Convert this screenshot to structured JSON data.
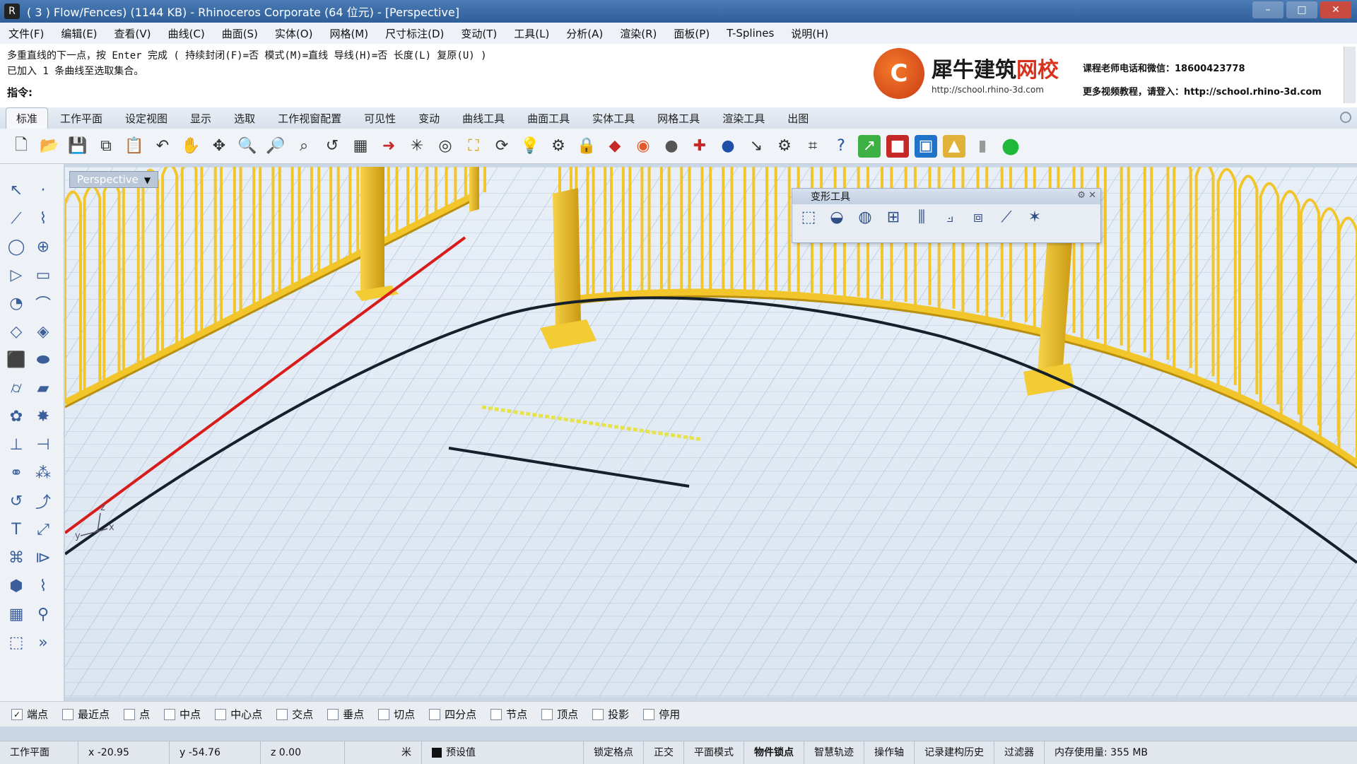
{
  "window": {
    "title": "( 3 ) Flow/Fences) (1144 KB) - Rhinoceros Corporate (64 位元) - [Perspective]",
    "controls": [
      "–",
      "□",
      "✕"
    ]
  },
  "menu": [
    "文件(F)",
    "编辑(E)",
    "查看(V)",
    "曲线(C)",
    "曲面(S)",
    "实体(O)",
    "网格(M)",
    "尺寸标注(D)",
    "变动(T)",
    "工具(L)",
    "分析(A)",
    "渲染(R)",
    "面板(P)",
    "T-Splines",
    "说明(H)"
  ],
  "command": {
    "history_line1": "多重直线的下一点，按 Enter 完成 ( 持续封闭(F)=否  模式(M)=直线  导线(H)=否  长度(L)  复原(U) )",
    "history_line2": "已加入 1 条曲线至选取集合。",
    "prompt_label": "指令:",
    "input_value": ""
  },
  "branding": {
    "logo_char": "C",
    "name_main": "犀牛建筑",
    "name_accent": "网校",
    "url": "http://school.rhino-3d.com",
    "contact_line1": "课程老师电话和微信：18600423778",
    "contact_line2": "更多视频教程，请登入：http://school.rhino-3d.com"
  },
  "tabs": [
    "标准",
    "工作平面",
    "设定视图",
    "显示",
    "选取",
    "工作视窗配置",
    "可见性",
    "变动",
    "曲线工具",
    "曲面工具",
    "实体工具",
    "网格工具",
    "渲染工具",
    "出图"
  ],
  "active_tab": 0,
  "viewport": {
    "name": "Perspective",
    "axis_x": "x",
    "axis_y": "y",
    "axis_z": "z"
  },
  "float_toolbar": {
    "title": "变形工具"
  },
  "osnaps": [
    {
      "label": "端点",
      "checked": true
    },
    {
      "label": "最近点",
      "checked": false
    },
    {
      "label": "点",
      "checked": false
    },
    {
      "label": "中点",
      "checked": false
    },
    {
      "label": "中心点",
      "checked": false
    },
    {
      "label": "交点",
      "checked": false
    },
    {
      "label": "垂点",
      "checked": false
    },
    {
      "label": "切点",
      "checked": false
    },
    {
      "label": "四分点",
      "checked": false
    },
    {
      "label": "节点",
      "checked": false
    },
    {
      "label": "顶点",
      "checked": false
    },
    {
      "label": "投影",
      "checked": false
    },
    {
      "label": "停用",
      "checked": false
    }
  ],
  "status": {
    "cplane": "工作平面",
    "x": "x -20.95",
    "y": "y -54.76",
    "z": "z 0.00",
    "unit": "米",
    "layer": "预设值",
    "grid_snap": "锁定格点",
    "ortho": "正交",
    "planar": "平面模式",
    "osnap": "物件锁点",
    "smarttrack": "智慧轨迹",
    "gumball": "操作轴",
    "history": "记录建构历史",
    "filter": "过滤器",
    "memory": "内存使用量: 355 MB"
  },
  "colors": {
    "fence": "#f2c62a",
    "fence_dark": "#b88f0e",
    "red_curve": "#d81c1c",
    "yellow_line": "#e6e34a"
  }
}
